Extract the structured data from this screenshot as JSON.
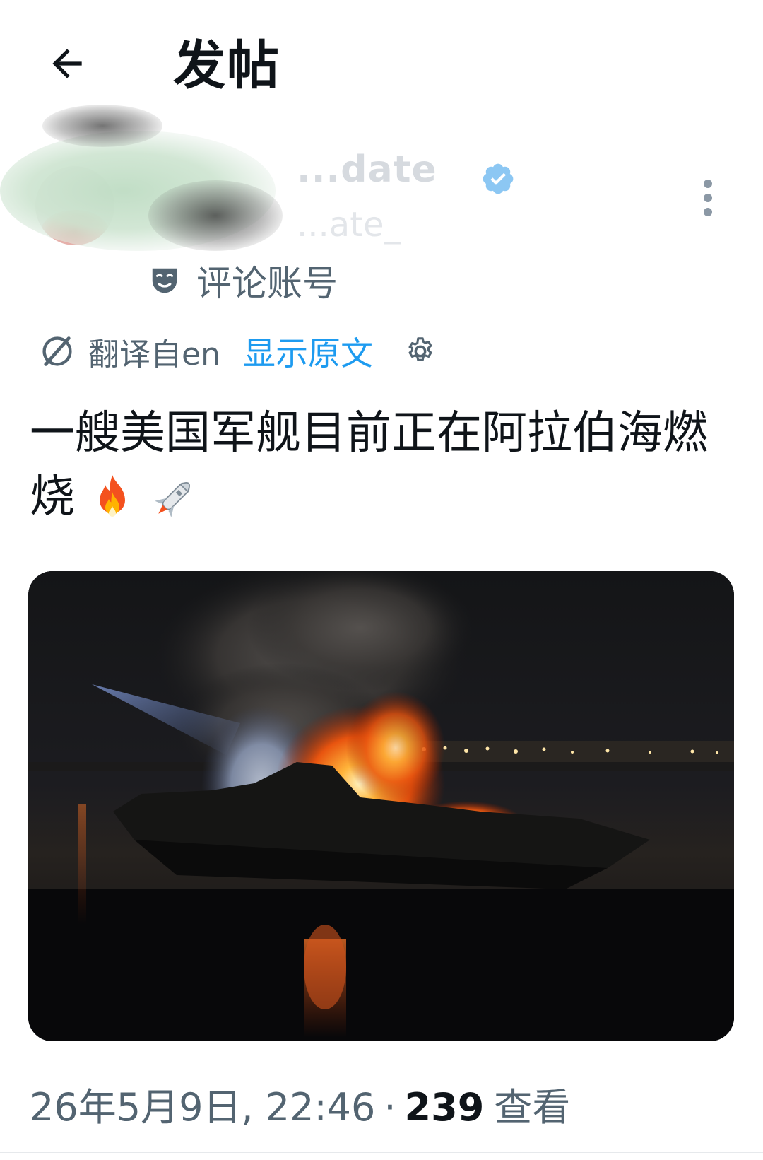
{
  "header": {
    "title": "发帖",
    "back_icon": "arrow-left-icon"
  },
  "author": {
    "display_name": "...date",
    "handle": "...ate_",
    "verified_icon": "verified-badge-icon",
    "verified_color": "#1d9bf0",
    "account_label": "评论账号",
    "account_label_icon": "mask-icon"
  },
  "translation": {
    "translated_from": "翻译自en",
    "show_original": "显示原文",
    "icons": [
      "translate-icon",
      "gear-icon"
    ]
  },
  "post": {
    "text": "一艘美国军舰目前正在阿拉伯海燃烧",
    "emoji": [
      "fire-emoji",
      "rocket-emoji"
    ],
    "media_description_icon": "burning-ship-photo"
  },
  "meta": {
    "timestamp": "26年5月9日, 22:46",
    "separator": "·",
    "views_count": "239",
    "views_label": "查看"
  },
  "colors": {
    "text_primary": "#0f1419",
    "text_secondary": "#536471",
    "link": "#1d9bf0",
    "divider": "#e6e9ec"
  }
}
